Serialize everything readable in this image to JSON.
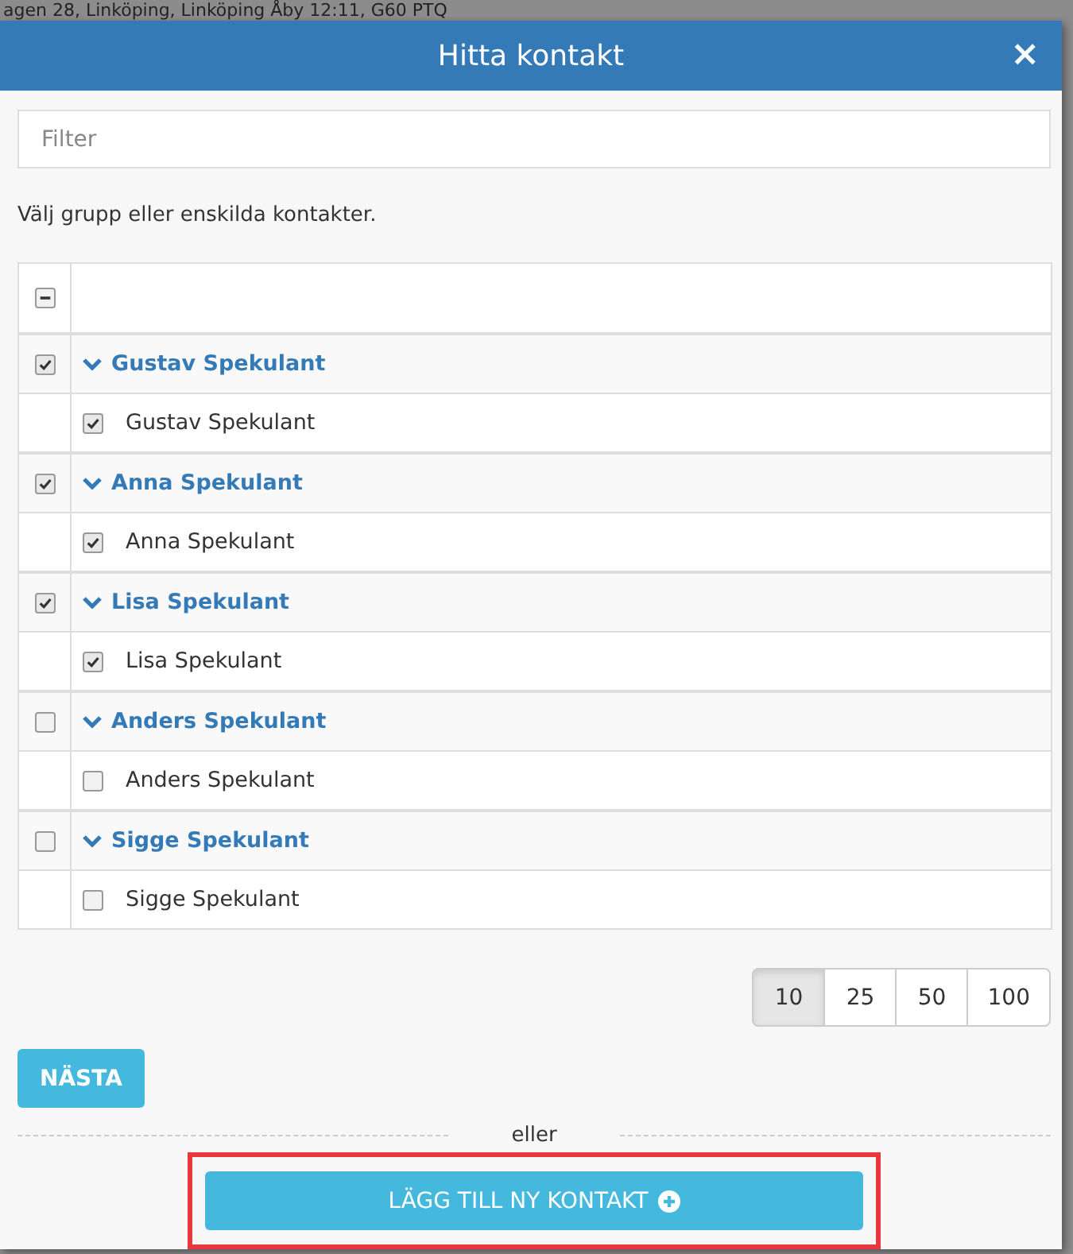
{
  "background_text": "agen 28, Linköping, Linköping Åby 12:11, G60 PTQ",
  "dialog": {
    "title": "Hitta kontakt",
    "close": "×"
  },
  "filter": {
    "placeholder": "Filter"
  },
  "instruction": "Välj grupp eller enskilda kontakter.",
  "select_all": {
    "partial": true
  },
  "groups": [
    {
      "name": "Gustav Spekulant",
      "checked": true,
      "expanded": true,
      "children": [
        {
          "name": "Gustav Spekulant",
          "checked": true
        }
      ]
    },
    {
      "name": "Anna Spekulant",
      "checked": true,
      "expanded": true,
      "children": [
        {
          "name": "Anna Spekulant",
          "checked": true
        }
      ]
    },
    {
      "name": "Lisa Spekulant",
      "checked": true,
      "expanded": true,
      "children": [
        {
          "name": "Lisa Spekulant",
          "checked": true
        }
      ]
    },
    {
      "name": "Anders Spekulant",
      "checked": false,
      "expanded": true,
      "children": [
        {
          "name": "Anders Spekulant",
          "checked": false
        }
      ]
    },
    {
      "name": "Sigge Spekulant",
      "checked": false,
      "expanded": true,
      "children": [
        {
          "name": "Sigge Spekulant",
          "checked": false
        }
      ]
    }
  ],
  "page_sizes": [
    {
      "label": "10",
      "selected": true
    },
    {
      "label": "25",
      "selected": false
    },
    {
      "label": "50",
      "selected": false
    },
    {
      "label": "100",
      "selected": false
    }
  ],
  "next_button": "NÄSTA",
  "separator": "eller",
  "add_button": {
    "label": "LÄGG TILL NY KONTAKT",
    "highlighted": true
  }
}
